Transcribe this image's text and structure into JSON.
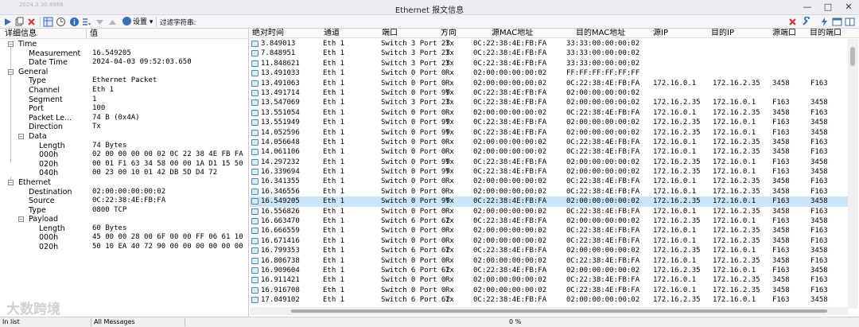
{
  "app": {
    "version": "2024.3.30.8986",
    "title": "Ethernet 报文信息",
    "window_controls": [
      "—",
      "□",
      "✕"
    ]
  },
  "toolbar": {
    "settings_label": "设置",
    "filter_label": "过滤字符串:",
    "filter_value": ""
  },
  "detail": {
    "col_field": "详细信息",
    "col_value": "值",
    "time_group": "Time",
    "measurement_label": "Measurement",
    "measurement_value": "16.549205",
    "datetime_label": "Date Time",
    "datetime_value": "2024-04-03 09:52:03.650",
    "general_group": "General",
    "type_label": "Type",
    "type_value": "Ethernet Packet",
    "channel_label": "Channel",
    "channel_value": "Eth 1",
    "segment_label": "Segment",
    "segment_value": "1",
    "port_label": "Port",
    "port_value": "100",
    "packetlen_label": "Packet Le...",
    "packetlen_value": "74 B (0x4A)",
    "direction_label": "Direction",
    "direction_value": "Tx",
    "data_group": "Data",
    "data_length_label": "Length",
    "data_length_value": "74 Bytes",
    "data_000h_label": "000h",
    "data_000h_value": "02 00 00 00 00 02 0C 22 38 4E FB FA",
    "data_020h_label": "020h",
    "data_020h_value": "00 01 F1 63 34 58 00 00 1A D1 15 50",
    "data_040h_label": "040h",
    "data_040h_value": "00 23 00 10 01 42 DB 5D D4 72",
    "ethernet_group": "Ethernet",
    "dest_label": "Destination",
    "dest_value": "02:00:00:00:00:02",
    "source_label": "Source",
    "source_value": "0C:22:38:4E:FB:FA",
    "eth_type_label": "Type",
    "eth_type_value": "0800 TCP",
    "payload_group": "Payload",
    "payload_length_label": "Length",
    "payload_length_value": "60 Bytes",
    "payload_000h_label": "000h",
    "payload_000h_value": "45 00 00 28 00 6F 00 00 FF 06 61 10",
    "payload_020h_label": "020h",
    "payload_020h_value": "50 10 EA 40 72 90 00 00 00 00 00 00"
  },
  "table": {
    "columns": [
      "绝对时间",
      "通道",
      "端口",
      "方向",
      "源MAC地址",
      "目的MAC地址",
      "源IP",
      "目的IP",
      "源端口",
      "目的端口"
    ],
    "rows": [
      [
        "3.849013",
        "Eth 1",
        "Switch 3 Port 23",
        "Tx",
        "0C:22:38:4E:FB:FA",
        "33:33:00:00:00:02",
        "",
        "",
        "",
        ""
      ],
      [
        "7.848951",
        "Eth 1",
        "Switch 3 Port 23",
        "Tx",
        "0C:22:38:4E:FB:FA",
        "33:33:00:00:00:02",
        "",
        "",
        "",
        ""
      ],
      [
        "11.848621",
        "Eth 1",
        "Switch 3 Port 23",
        "Tx",
        "0C:22:38:4E:FB:FA",
        "33:33:00:00:00:02",
        "",
        "",
        "",
        ""
      ],
      [
        "13.491033",
        "Eth 1",
        "Switch 0 Port 0",
        "Rx",
        "02:00:00:00:00:02",
        "FF:FF:FF:FF:FF:FF",
        "",
        "",
        "",
        ""
      ],
      [
        "13.491063",
        "Eth 1",
        "Switch 0 Port 0",
        "Rx",
        "02:00:00:00:00:02",
        "0C:22:38:4E:FB:FA",
        "172.16.0.1",
        "172.16.2.35",
        "3458",
        "F163"
      ],
      [
        "13.491714",
        "Eth 1",
        "Switch 0 Port 99",
        "Tx",
        "0C:22:38:4E:FB:FA",
        "02:00:00:00:00:02",
        "",
        "",
        "",
        ""
      ],
      [
        "13.547069",
        "Eth 1",
        "Switch 3 Port 23",
        "Tx",
        "0C:22:38:4E:FB:FA",
        "02:00:00:00:00:02",
        "172.16.2.35",
        "172.16.0.1",
        "F163",
        "3458"
      ],
      [
        "13.551054",
        "Eth 1",
        "Switch 0 Port 0",
        "Rx",
        "02:00:00:00:00:02",
        "0C:22:38:4E:FB:FA",
        "172.16.0.1",
        "172.16.2.35",
        "3458",
        "F163"
      ],
      [
        "13.551949",
        "Eth 1",
        "Switch 0 Port 99",
        "Tx",
        "0C:22:38:4E:FB:FA",
        "02:00:00:00:00:02",
        "172.16.2.35",
        "172.16.0.1",
        "F163",
        "3458"
      ],
      [
        "14.052596",
        "Eth 1",
        "Switch 0 Port 99",
        "Tx",
        "0C:22:38:4E:FB:FA",
        "02:00:00:00:00:02",
        "172.16.2.35",
        "172.16.0.1",
        "F163",
        "3458"
      ],
      [
        "14.056648",
        "Eth 1",
        "Switch 0 Port 0",
        "Rx",
        "02:00:00:00:00:02",
        "0C:22:38:4E:FB:FA",
        "172.16.0.1",
        "172.16.2.35",
        "3458",
        "F163"
      ],
      [
        "14.061106",
        "Eth 1",
        "Switch 0 Port 0",
        "Rx",
        "02:00:00:00:00:02",
        "0C:22:38:4E:FB:FA",
        "172.16.0.1",
        "172.16.2.35",
        "3458",
        "F163"
      ],
      [
        "14.297232",
        "Eth 1",
        "Switch 0 Port 99",
        "Tx",
        "0C:22:38:4E:FB:FA",
        "02:00:00:00:00:02",
        "172.16.2.35",
        "172.16.0.1",
        "F163",
        "3458"
      ],
      [
        "16.339694",
        "Eth 1",
        "Switch 0 Port 99",
        "Tx",
        "0C:22:38:4E:FB:FA",
        "02:00:00:00:00:02",
        "172.16.2.35",
        "172.16.0.1",
        "F163",
        "3458"
      ],
      [
        "16.341355",
        "Eth 1",
        "Switch 0 Port 0",
        "Rx",
        "02:00:00:00:00:02",
        "0C:22:38:4E:FB:FA",
        "172.16.0.1",
        "172.16.2.35",
        "3458",
        "F163"
      ],
      [
        "16.346556",
        "Eth 1",
        "Switch 0 Port 0",
        "Rx",
        "02:00:00:00:00:02",
        "0C:22:38:4E:FB:FA",
        "172.16.0.1",
        "172.16.2.35",
        "3458",
        "F163"
      ],
      [
        "16.549205",
        "Eth 1",
        "Switch 0 Port 99",
        "Tx",
        "0C:22:38:4E:FB:FA",
        "02:00:00:00:00:02",
        "172.16.2.35",
        "172.16.0.1",
        "F163",
        "3458"
      ],
      [
        "16.556826",
        "Eth 1",
        "Switch 0 Port 0",
        "Rx",
        "02:00:00:00:00:02",
        "0C:22:38:4E:FB:FA",
        "172.16.0.1",
        "172.16.2.35",
        "3458",
        "F163"
      ],
      [
        "16.663470",
        "Eth 1",
        "Switch 6 Port 62",
        "Tx",
        "0C:22:38:4E:FB:FA",
        "02:00:00:00:00:02",
        "172.16.2.35",
        "172.16.0.1",
        "F163",
        "3458"
      ],
      [
        "16.666559",
        "Eth 1",
        "Switch 0 Port 0",
        "Rx",
        "02:00:00:00:00:02",
        "0C:22:38:4E:FB:FA",
        "172.16.0.1",
        "172.16.2.35",
        "3458",
        "F163"
      ],
      [
        "16.671416",
        "Eth 1",
        "Switch 0 Port 0",
        "Rx",
        "02:00:00:00:00:02",
        "0C:22:38:4E:FB:FA",
        "172.16.0.1",
        "172.16.2.35",
        "3458",
        "F163"
      ],
      [
        "16.799353",
        "Eth 1",
        "Switch 6 Port 62",
        "Tx",
        "0C:22:38:4E:FB:FA",
        "02:00:00:00:00:02",
        "172.16.2.35",
        "172.16.0.1",
        "F163",
        "3458"
      ],
      [
        "16.806738",
        "Eth 1",
        "Switch 0 Port 0",
        "Rx",
        "02:00:00:00:00:02",
        "0C:22:38:4E:FB:FA",
        "172.16.0.1",
        "172.16.2.35",
        "3458",
        "F163"
      ],
      [
        "16.909604",
        "Eth 1",
        "Switch 6 Port 62",
        "Tx",
        "0C:22:38:4E:FB:FA",
        "02:00:00:00:00:02",
        "172.16.2.35",
        "172.16.0.1",
        "F163",
        "3458"
      ],
      [
        "16.911421",
        "Eth 1",
        "Switch 0 Port 0",
        "Rx",
        "02:00:00:00:00:02",
        "0C:22:38:4E:FB:FA",
        "172.16.0.1",
        "172.16.2.35",
        "3458",
        "F163"
      ],
      [
        "16.916708",
        "Eth 1",
        "Switch 0 Port 0",
        "Rx",
        "02:00:00:00:00:02",
        "0C:22:38:4E:FB:FA",
        "172.16.0.1",
        "172.16.2.35",
        "3458",
        "F163"
      ],
      [
        "17.049102",
        "Eth 1",
        "Switch 6 Port 62",
        "Tx",
        "0C:22:38:4E:FB:FA",
        "02:00:00:00:00:02",
        "172.16.2.35",
        "172.16.0.1",
        "F163",
        "3458"
      ]
    ],
    "selected_row": 16
  },
  "status": {
    "left": "In list",
    "mode": "All Messages",
    "progress": "0 %"
  },
  "watermark": "大数跨境",
  "colors": {
    "accent": "#3b6fb6",
    "selection": "#cce4f7",
    "close_red": "#d9322c"
  }
}
